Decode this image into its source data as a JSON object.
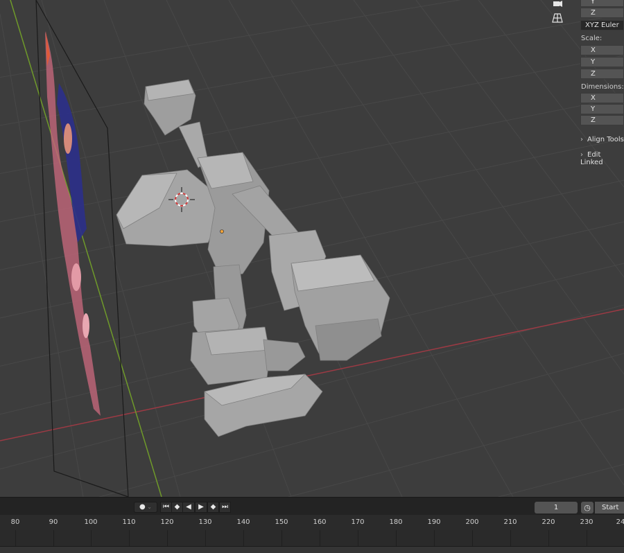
{
  "app": "Blender",
  "colors": {
    "viewport_bg": "#3d3d3d",
    "grid_line": "#474747",
    "x_axis": "#9c3a44",
    "y_axis": "#6f9a2a",
    "mesh": "#a8a8a8",
    "timeline_bg": "#232323"
  },
  "navigation_icons": [
    "camera-icon",
    "perspective-grid-icon"
  ],
  "sidebar": {
    "rotation_y_label": "Y",
    "rotation_z_label": "Z",
    "rotation_mode": "XYZ Euler",
    "scale_label": "Scale:",
    "scale_x": "X",
    "scale_y": "Y",
    "scale_z": "Z",
    "dimensions_label": "Dimensions:",
    "dim_x": "X",
    "dim_y": "Y",
    "dim_z": "Z",
    "panels": [
      "Align Tools",
      "Edit Linked"
    ]
  },
  "timeline": {
    "current_frame": "1",
    "start_label": "Start",
    "ruler_ticks": [
      "80",
      "90",
      "100",
      "110",
      "120",
      "130",
      "140",
      "150",
      "160",
      "170",
      "180",
      "190",
      "200",
      "210",
      "220",
      "230",
      "24"
    ]
  },
  "playback_icons": [
    "record-icon",
    "jump-start-icon",
    "prev-keyframe-icon",
    "play-reverse-icon",
    "play-icon",
    "next-keyframe-icon",
    "jump-end-icon"
  ]
}
